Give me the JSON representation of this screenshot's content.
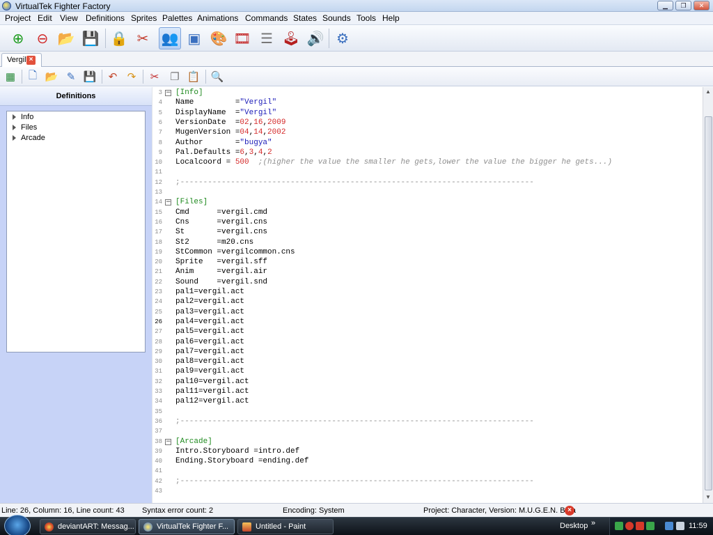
{
  "window": {
    "title": "VirtualTek Fighter Factory"
  },
  "menu": [
    "Project",
    "Edit",
    "View",
    "Definitions",
    "Sprites",
    "Palettes",
    "Animations",
    "Commands",
    "States",
    "Sounds",
    "Tools",
    "Help"
  ],
  "tab": {
    "label": "Vergil"
  },
  "left_panel": {
    "title": "Definitions",
    "tree": [
      "Info",
      "Files",
      "Arcade"
    ]
  },
  "editor": {
    "lines": [
      {
        "n": "3",
        "t": "[Info]",
        "k": "sec",
        "fold": true
      },
      {
        "n": "4",
        "t": "Name         =\"Vergil\""
      },
      {
        "n": "5",
        "t": "DisplayName  =\"Vergil\""
      },
      {
        "n": "6",
        "t": "VersionDate  =02,16,2009"
      },
      {
        "n": "7",
        "t": "MugenVersion =04,14,2002"
      },
      {
        "n": "8",
        "t": "Author       =\"bugya\""
      },
      {
        "n": "9",
        "t": "Pal.Defaults =6,3,4,2"
      },
      {
        "n": "10",
        "t": "Localcoord = 500  ;(higher the value the smaller he gets,lower the value the bigger he gets...)"
      },
      {
        "n": "11",
        "t": ""
      },
      {
        "n": "12",
        "t": ";-----------------------------------------------------------------------------",
        "k": "cmt"
      },
      {
        "n": "13",
        "t": ""
      },
      {
        "n": "14",
        "t": "[Files]",
        "k": "sec",
        "fold": true
      },
      {
        "n": "15",
        "t": "Cmd      =vergil.cmd"
      },
      {
        "n": "16",
        "t": "Cns      =vergil.cns"
      },
      {
        "n": "17",
        "t": "St       =vergil.cns"
      },
      {
        "n": "18",
        "t": "St2      =m20.cns"
      },
      {
        "n": "19",
        "t": "StCommon =vergilcommon.cns"
      },
      {
        "n": "20",
        "t": "Sprite   =vergil.sff"
      },
      {
        "n": "21",
        "t": "Anim     =vergil.air"
      },
      {
        "n": "22",
        "t": "Sound    =vergil.snd"
      },
      {
        "n": "23",
        "t": "pal1=vergil.act"
      },
      {
        "n": "24",
        "t": "pal2=vergil.act"
      },
      {
        "n": "25",
        "t": "pal3=vergil.act"
      },
      {
        "n": "26",
        "t": "pal4=vergil.act",
        "cur": true
      },
      {
        "n": "27",
        "t": "pal5=vergil.act"
      },
      {
        "n": "28",
        "t": "pal6=vergil.act"
      },
      {
        "n": "29",
        "t": "pal7=vergil.act"
      },
      {
        "n": "30",
        "t": "pal8=vergil.act"
      },
      {
        "n": "31",
        "t": "pal9=vergil.act"
      },
      {
        "n": "32",
        "t": "pal10=vergil.act"
      },
      {
        "n": "33",
        "t": "pal11=vergil.act"
      },
      {
        "n": "34",
        "t": "pal12=vergil.act"
      },
      {
        "n": "35",
        "t": ""
      },
      {
        "n": "36",
        "t": ";-----------------------------------------------------------------------------",
        "k": "cmt"
      },
      {
        "n": "37",
        "t": ""
      },
      {
        "n": "38",
        "t": "[Arcade]",
        "k": "sec",
        "fold": true
      },
      {
        "n": "39",
        "t": "Intro.Storyboard =intro.def"
      },
      {
        "n": "40",
        "t": "Ending.Storyboard =ending.def"
      },
      {
        "n": "41",
        "t": ""
      },
      {
        "n": "42",
        "t": ";-----------------------------------------------------------------------------",
        "k": "cmt"
      },
      {
        "n": "43",
        "t": ""
      }
    ]
  },
  "status": {
    "position": "Line: 26, Column: 16, Line count: 43",
    "syntax": "Syntax error count: 2",
    "encoding": "Encoding: System",
    "project": "Project: Character, Version: M.U.G.E.N. Beta"
  },
  "taskbar": {
    "items": [
      "deviantART: Messag...",
      "VirtualTek Fighter F...",
      "Untitled - Paint"
    ],
    "desktop": "Desktop",
    "clock": "11:59"
  }
}
